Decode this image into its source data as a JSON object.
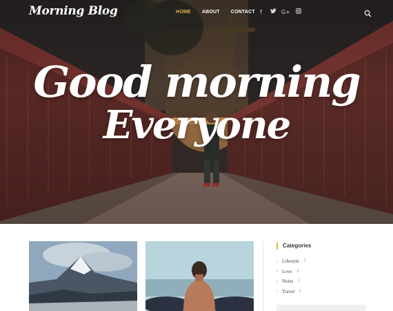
{
  "brand": {
    "logo": "Morning Blog"
  },
  "nav": {
    "items": [
      {
        "label": "HOME",
        "active": true
      },
      {
        "label": "ABOUT",
        "active": false
      },
      {
        "label": "CONTACT",
        "active": false
      }
    ],
    "accent": "#e5b24a"
  },
  "social": {
    "icons": [
      {
        "name": "facebook-icon",
        "glyph": "f"
      },
      {
        "name": "twitter-icon",
        "glyph": "t"
      },
      {
        "name": "google-plus-icon",
        "glyph": "G+"
      },
      {
        "name": "instagram-icon",
        "glyph": "◻"
      }
    ]
  },
  "hero": {
    "line1": "Good morning",
    "line2": "Everyone"
  },
  "sidebar": {
    "title": "Categories",
    "categories": [
      {
        "name": "Lifestyle",
        "count": "5"
      },
      {
        "name": "Love",
        "count": "3"
      },
      {
        "name": "Notes",
        "count": "3"
      },
      {
        "name": "Travel",
        "count": "5"
      }
    ]
  }
}
